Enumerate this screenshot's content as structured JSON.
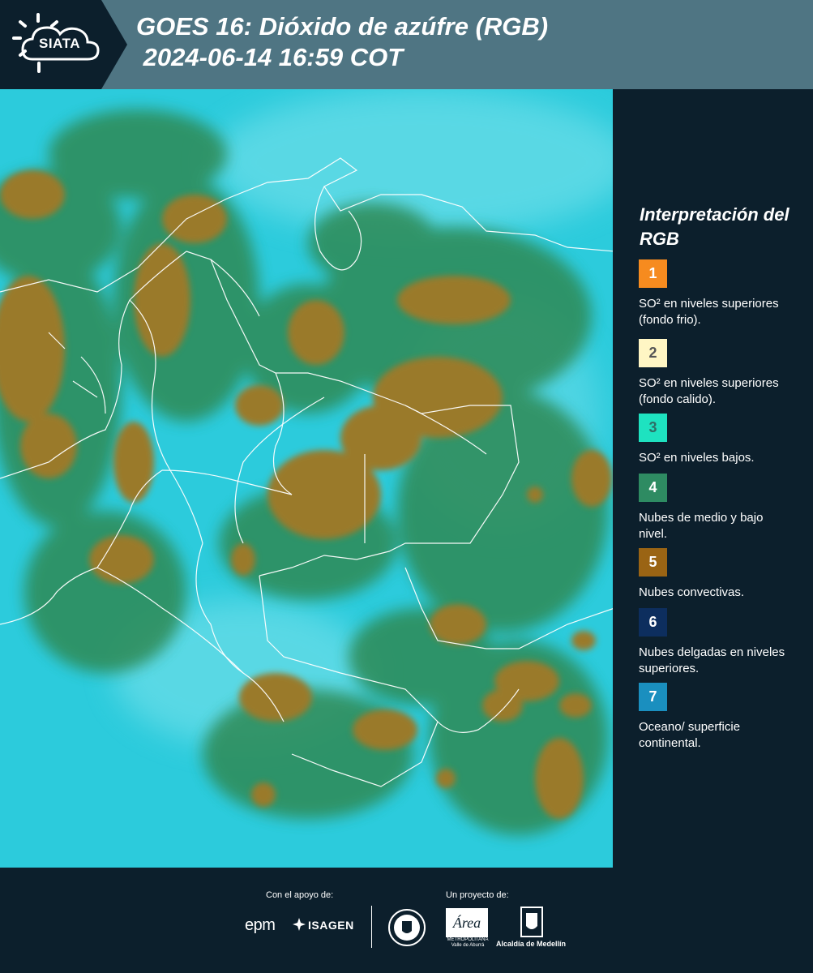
{
  "header": {
    "logo_text": "SIATA",
    "title": "GOES 16: Dióxido de azúfre (RGB)\n 2024-06-14 16:59 COT"
  },
  "map": {
    "image_type": "satellite-rgb-composite",
    "colors": {
      "background": "#28c8da",
      "clouds_convective": "#9a7a2c",
      "clouds_mid_low": "#2f8a55",
      "borders": "#ffffff"
    }
  },
  "legend": {
    "title": "Interpretación del RGB",
    "items": [
      {
        "number": "1",
        "label": "SO² en niveles superiores (fondo frio).",
        "color": "#f68b1f",
        "text_color": "#ffffff"
      },
      {
        "number": "2",
        "label": "SO² en niveles superiores (fondo calido).",
        "color": "#fff6c4",
        "text_color": "#555555"
      },
      {
        "number": "3",
        "label": "SO² en niveles bajos.",
        "color": "#1ee2c0",
        "text_color": "#2e6e66"
      },
      {
        "number": "4",
        "label": "Nubes de medio y bajo nivel.",
        "color": "#2e8b62",
        "text_color": "#ffffff"
      },
      {
        "number": "5",
        "label": "Nubes convectivas.",
        "color": "#9a6414",
        "text_color": "#ffffff"
      },
      {
        "number": "6",
        "label": "Nubes delgadas en niveles superiores.",
        "color": "#0d2e5e",
        "text_color": "#ffffff"
      },
      {
        "number": "7",
        "label": "Oceano/ superficie continental.",
        "color": "#1a8fbf",
        "text_color": "#ffffff"
      }
    ]
  },
  "footer": {
    "support_label": "Con el apoyo de:",
    "project_label": "Un proyecto de:",
    "epm": "epm",
    "isagen": "ISAGEN",
    "area_text": "METROPOLITANA Valle de Aburrá",
    "alcaldia": "Alcaldía de Medellín"
  }
}
